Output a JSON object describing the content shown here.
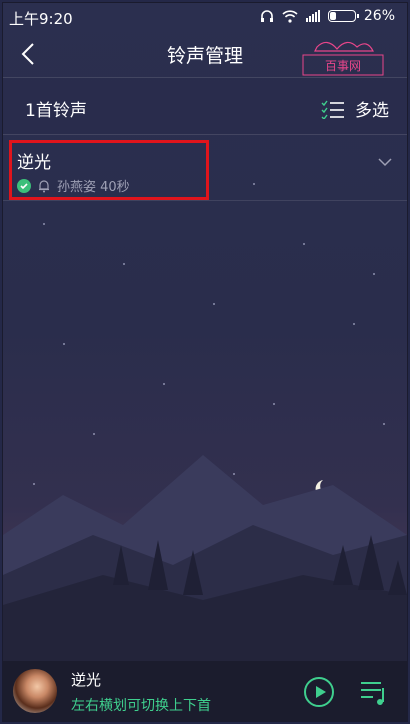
{
  "status": {
    "time": "上午9:20",
    "battery": "26%"
  },
  "header": {
    "title": "铃声管理",
    "watermark": "百事网"
  },
  "subheader": {
    "count": "1首铃声",
    "multi_select": "多选"
  },
  "ringtones": [
    {
      "title": "逆光",
      "artist_duration": "孙燕姿 40秒"
    }
  ],
  "player": {
    "song": "逆光",
    "hint": "左右横划可切换上下首"
  },
  "colors": {
    "accent": "#3fcf8e",
    "highlight_box": "#e0141c"
  }
}
